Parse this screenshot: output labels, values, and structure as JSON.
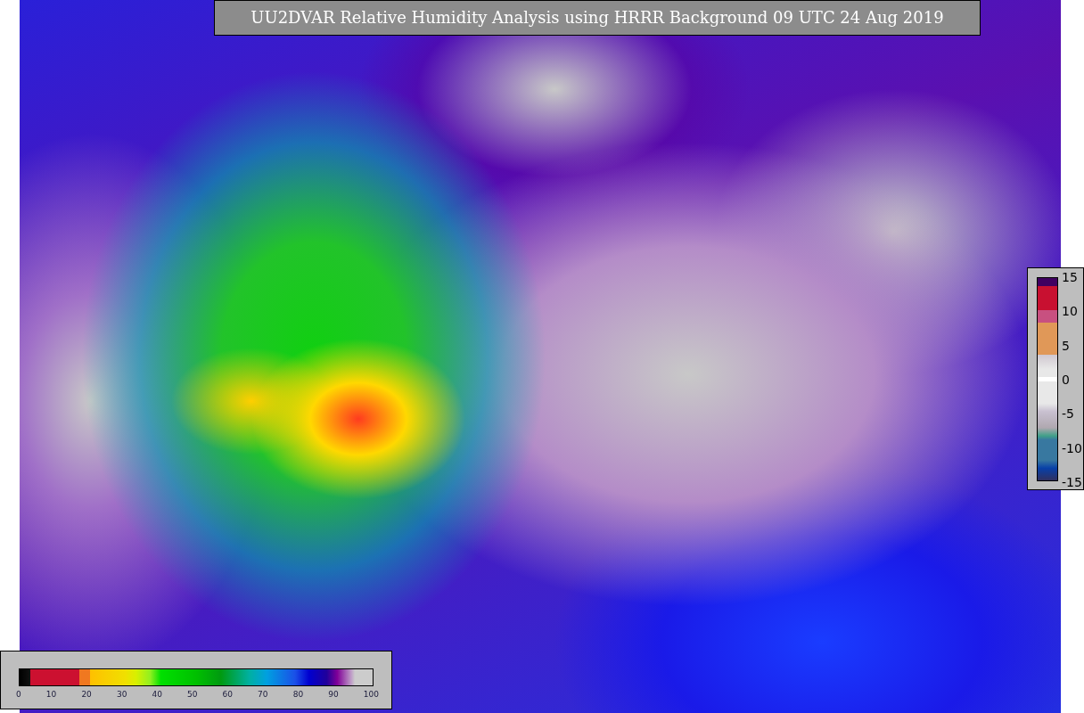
{
  "title": "UU2DVAR Relative Humidity Analysis using HRRR Background 09 UTC 24 Aug 2019",
  "humidity_colorbar": {
    "ticks": [
      "0",
      "10",
      "20",
      "30",
      "40",
      "50",
      "60",
      "70",
      "80",
      "90",
      "100"
    ]
  },
  "change_colorbar": {
    "ticks": [
      "15",
      "10",
      "5",
      "0",
      "-5",
      "-10",
      "-15"
    ]
  }
}
